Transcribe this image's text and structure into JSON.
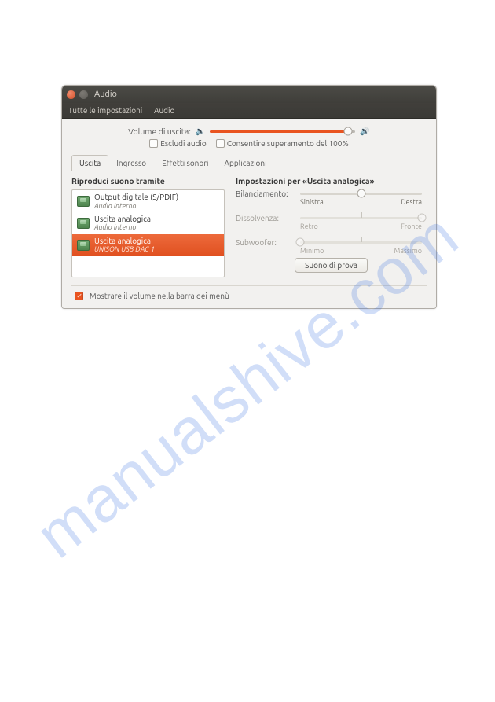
{
  "watermark": "manualshive.com",
  "window": {
    "title": "Audio",
    "breadcrumb": {
      "all": "Tutte le impostazioni",
      "current": "Audio"
    }
  },
  "volume": {
    "label": "Volume di uscita:",
    "mute_label": "Escludi audio",
    "allow_over_label": "Consentire superamento del 100%"
  },
  "tabs": {
    "output": "Uscita",
    "input": "Ingresso",
    "effects": "Effetti sonori",
    "apps": "Applicazioni"
  },
  "left": {
    "title": "Riproduci suono tramite",
    "devices": [
      {
        "name": "Output digitale (S/PDIF)",
        "sub": "Audio interno"
      },
      {
        "name": "Uscita analogica",
        "sub": "Audio interno"
      },
      {
        "name": "Uscita analogica",
        "sub": "UNISON USB DAC 1"
      }
    ]
  },
  "right": {
    "title": "Impostazioni per «Uscita analogica»",
    "balance": {
      "label": "Bilanciamento:",
      "left": "Sinistra",
      "right": "Destra"
    },
    "fade": {
      "label": "Dissolvenza:",
      "left": "Retro",
      "right": "Fronte"
    },
    "sub": {
      "label": "Subwoofer:",
      "left": "Minimo",
      "right": "Massimo"
    },
    "test_btn": "Suono di prova"
  },
  "footer": {
    "show_in_menu": "Mostrare il volume nella barra dei menù"
  }
}
